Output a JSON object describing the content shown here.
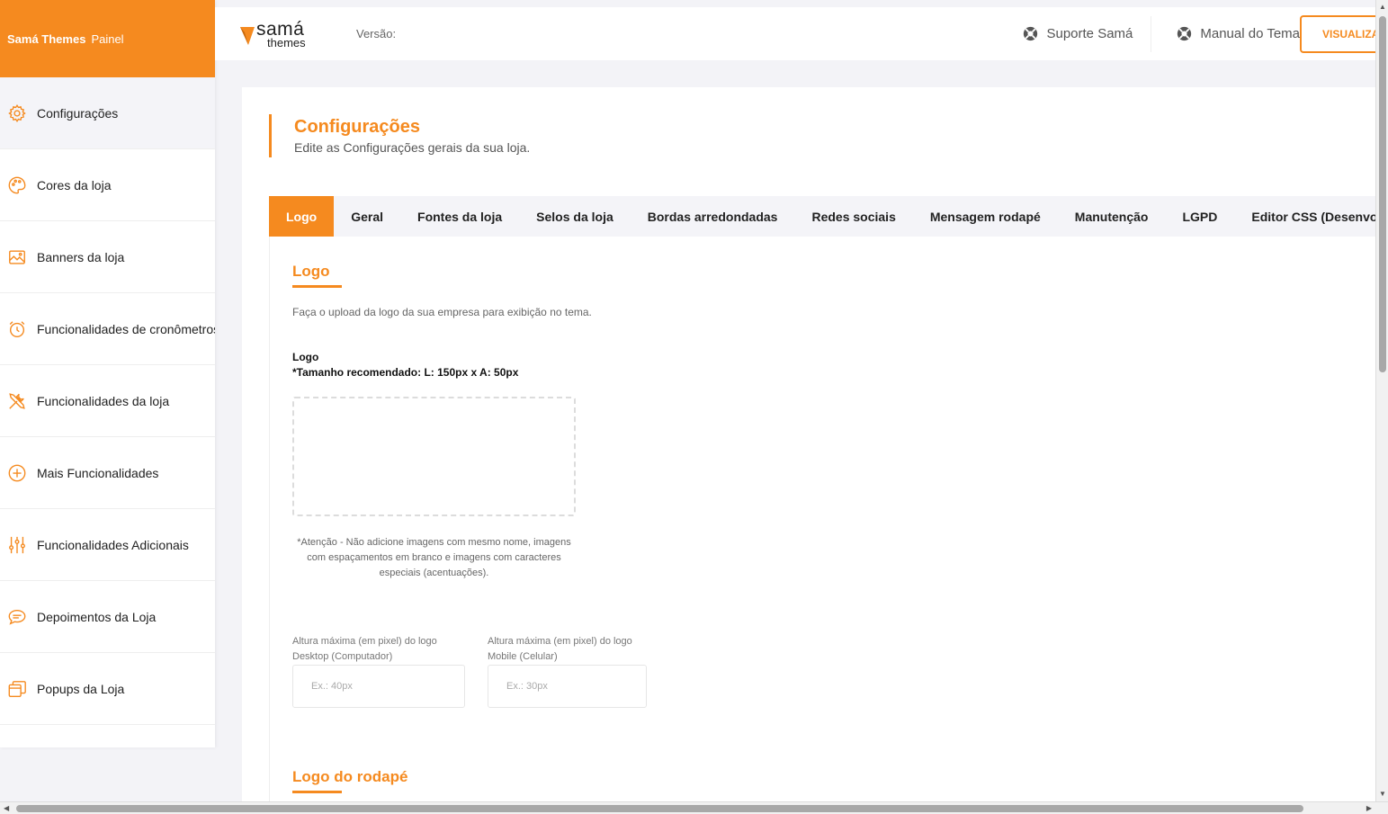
{
  "colors": {
    "accent": "#f58a1f",
    "text": "#222222",
    "muted": "#666666",
    "background": "#f3f3f7"
  },
  "sidebar": {
    "brand": "Samá Themes",
    "brand_suffix": "Painel",
    "items": [
      {
        "label": "Configurações",
        "icon": "gear-icon"
      },
      {
        "label": "Cores da loja",
        "icon": "palette-icon"
      },
      {
        "label": "Banners da loja",
        "icon": "image-icon"
      },
      {
        "label": "Funcionalidades de cronômetros",
        "icon": "alarm-clock-icon"
      },
      {
        "label": "Funcionalidades da loja",
        "icon": "tools-icon"
      },
      {
        "label": "Mais Funcionalidades",
        "icon": "plus-circle-icon"
      },
      {
        "label": "Funcionalidades Adicionais",
        "icon": "sliders-icon"
      },
      {
        "label": "Depoimentos da Loja",
        "icon": "chat-icon"
      },
      {
        "label": "Popups da Loja",
        "icon": "popup-window-icon"
      }
    ]
  },
  "topbar": {
    "logo_line1": "samá",
    "logo_line2": "themes",
    "version_label": "Versão:",
    "support_label": "Suporte Samá",
    "manual_label": "Manual do Tema",
    "view_button": "VISUALIZAR"
  },
  "page": {
    "title": "Configurações",
    "subtitle": "Edite as Configurações gerais da sua loja."
  },
  "tabs": [
    "Logo",
    "Geral",
    "Fontes da loja",
    "Selos da loja",
    "Bordas arredondadas",
    "Redes sociais",
    "Mensagem rodapé",
    "Manutenção",
    "LGPD",
    "Editor CSS (Desenvolvedor)"
  ],
  "logo_section": {
    "title": "Logo",
    "description": "Faça o upload da logo da sua empresa para exibição no tema.",
    "field_label": "Logo",
    "field_size_hint": "*Tamanho recomendado: L: 150px x A: 50px",
    "warning": "*Atenção - Não adicione imagens com mesmo nome, imagens com espaçamentos em branco e imagens com caracteres especiais (acentuações).",
    "desktop_height_label": "Altura máxima (em pixel) do logo Desktop (Computador)",
    "desktop_height_placeholder": "Ex.: 40px",
    "mobile_height_label": "Altura máxima (em pixel) do logo Mobile (Celular)",
    "mobile_height_placeholder": "Ex.: 30px"
  },
  "footer_logo_section": {
    "title": "Logo do rodapé"
  }
}
